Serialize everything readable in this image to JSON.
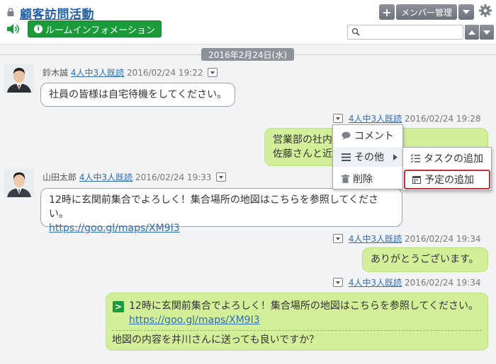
{
  "header": {
    "title": "顧客訪問活動",
    "room_info_label": "ルームインフォメーション",
    "member_btn_label": "メンバー管理",
    "add_btn_label": "+",
    "search_placeholder": ""
  },
  "date_divider": "2016年2月24日(水)",
  "messages": [
    {
      "sender": "鈴木誠",
      "read": "4人中3人既読",
      "time": "2016/02/24 19:22",
      "text": "社員の皆様は自宅待機をしてください。"
    },
    {
      "read": "4人中3人既読",
      "time": "2016/02/24 19:28",
      "line1": "営業部の社内会",
      "line2": "佐藤さんと近藤"
    },
    {
      "sender": "山田太郎",
      "read": "4人中3人既読",
      "time": "2016/02/24 19:33",
      "line1": "12時に玄関前集合でよろしく！集合場所の地図はこちらを参照してください。",
      "link": "https://goo.gl/maps/XM9I3"
    },
    {
      "read": "4人中3人既読",
      "time": "2016/02/24 19:34",
      "text": "ありがとうございます。"
    },
    {
      "read": "4人中3人既読",
      "time": "2016/02/24 19:34",
      "quote_line1": "12時に玄関前集合でよろしく！集合場所の地図はこちらを参照してください。",
      "quote_link": "https://goo.gl/maps/XM9I3",
      "text": "地図の内容を井川さんに送っても良いですか？"
    }
  ],
  "context_menu": {
    "comment": "コメント",
    "other": "その他",
    "delete": "削除"
  },
  "submenu": {
    "add_task": "タスクの追加",
    "add_schedule": "予定の追加"
  },
  "colors": {
    "accent": "#1f5fa8",
    "green": "#1c9b3a",
    "bubble_self": "#d3ef9a",
    "highlight": "#c0303a"
  }
}
